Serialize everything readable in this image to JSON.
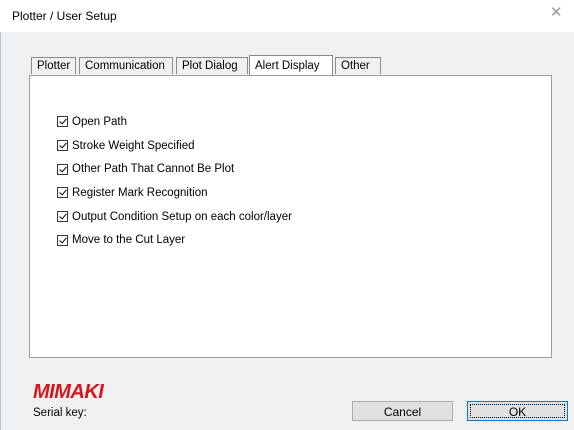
{
  "window": {
    "title": "Plotter / User Setup",
    "close_icon": "close-icon"
  },
  "tabs": [
    {
      "label": "Plotter",
      "active": false
    },
    {
      "label": "Communication",
      "active": false
    },
    {
      "label": "Plot Dialog",
      "active": false
    },
    {
      "label": "Alert Display",
      "active": true
    },
    {
      "label": "Other",
      "active": false
    }
  ],
  "alerts": [
    {
      "label": "Open Path",
      "checked": true
    },
    {
      "label": "Stroke Weight Specified",
      "checked": true
    },
    {
      "label": "Other Path That Cannot Be Plot",
      "checked": true
    },
    {
      "label": "Register Mark Recognition",
      "checked": true
    },
    {
      "label": "Output Condition Setup on each color/layer",
      "checked": true
    },
    {
      "label": "Move to the Cut Layer",
      "checked": true
    }
  ],
  "footer": {
    "logo_text": "MIMAKI",
    "serial_label": "Serial key:",
    "cancel_label": "Cancel",
    "ok_label": "OK"
  },
  "colors": {
    "brand": "#d4171f",
    "focus": "#0078d7"
  }
}
